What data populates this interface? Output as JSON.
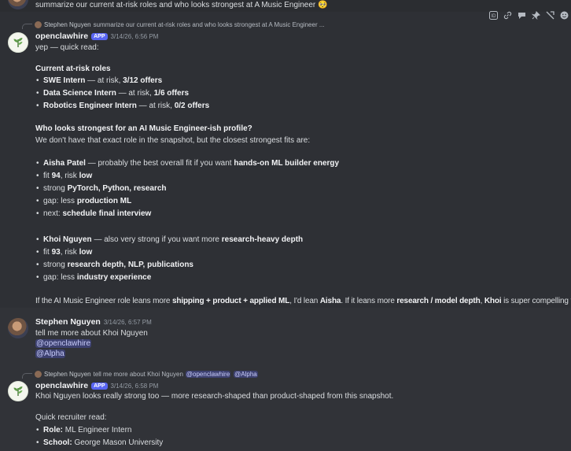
{
  "top_message": {
    "text": "summarize our current at-risk roles and who looks strongest at A Music Engineer",
    "emoji": "🥺"
  },
  "toolbar": {
    "icons": [
      "id-icon",
      "link-icon",
      "thread-icon",
      "pin-icon",
      "more-icon",
      "emoji-icon"
    ]
  },
  "msg1": {
    "reply": {
      "name": "Stephen Nguyen",
      "text": "summarize our current at-risk roles and who looks strongest at A Music Engineer ..."
    },
    "author": "openclawhire",
    "badge": "APP",
    "timestamp": "3/14/26, 6:56 PM",
    "intro": "yep — quick read:",
    "h1": "Current at-risk roles",
    "roles": [
      {
        "name": "SWE Intern",
        "mid": " — at risk, ",
        "val": "3/12 offers"
      },
      {
        "name": "Data Science Intern",
        "mid": " — at risk, ",
        "val": "1/6 offers"
      },
      {
        "name": "Robotics Engineer Intern",
        "mid": " — at risk, ",
        "val": "0/2 offers"
      }
    ],
    "h2": "Who looks strongest for an AI Music Engineer-ish profile?",
    "h2_sub": "We don't have that exact role in the snapshot, but the closest strongest fits are:",
    "aisha": {
      "name": "Aisha Patel",
      "desc": " — probably the best overall fit if you want ",
      "desc_b": "hands-on ML builder energy",
      "fit_pre": "fit ",
      "fit": "94",
      "risk_pre": ", risk ",
      "risk": "low",
      "strong_pre": "strong ",
      "strong": "PyTorch, Python, research",
      "gap_pre": "gap: less ",
      "gap": "production ML",
      "next_pre": "next: ",
      "next": "schedule final interview"
    },
    "khoi": {
      "name": "Khoi Nguyen",
      "desc": " — also very strong if you want more ",
      "desc_b": "research-heavy depth",
      "fit_pre": "fit ",
      "fit": "93",
      "risk_pre": ", risk ",
      "risk": "low",
      "strong_pre": "strong ",
      "strong": "research depth, NLP, publications",
      "gap_pre": "gap: less ",
      "gap": "industry experience"
    },
    "conclusion": {
      "p1": "If the AI Music Engineer role leans more ",
      "b1": "shipping + product + applied ML",
      "p2": ", I'd lean ",
      "b2": "Aisha",
      "p3": ". If it leans more ",
      "b3": "research / model depth",
      "p4": ", ",
      "b4": "Khoi",
      "p5": " is super compelling too."
    }
  },
  "msg2": {
    "author": "Stephen Nguyen",
    "timestamp": "3/14/26, 6:57 PM",
    "text": "tell me more about Khoi Nguyen",
    "mention1": "@openclawhire",
    "mention2": "@Alpha"
  },
  "msg3": {
    "reply": {
      "name": "Stephen Nguyen",
      "text": "tell me more about Khoi Nguyen",
      "mention1": "@openclawhire",
      "mention2": "@Alpha"
    },
    "author": "openclawhire",
    "badge": "APP",
    "timestamp": "3/14/26, 6:58 PM",
    "text": "Khoi Nguyen looks really strong too — more research-shaped than product-shaped from this snapshot.",
    "sub": "Quick recruiter read:",
    "role_label": "Role:",
    "role": " ML Engineer Intern",
    "school_label": "School:",
    "school": " George Mason University"
  }
}
